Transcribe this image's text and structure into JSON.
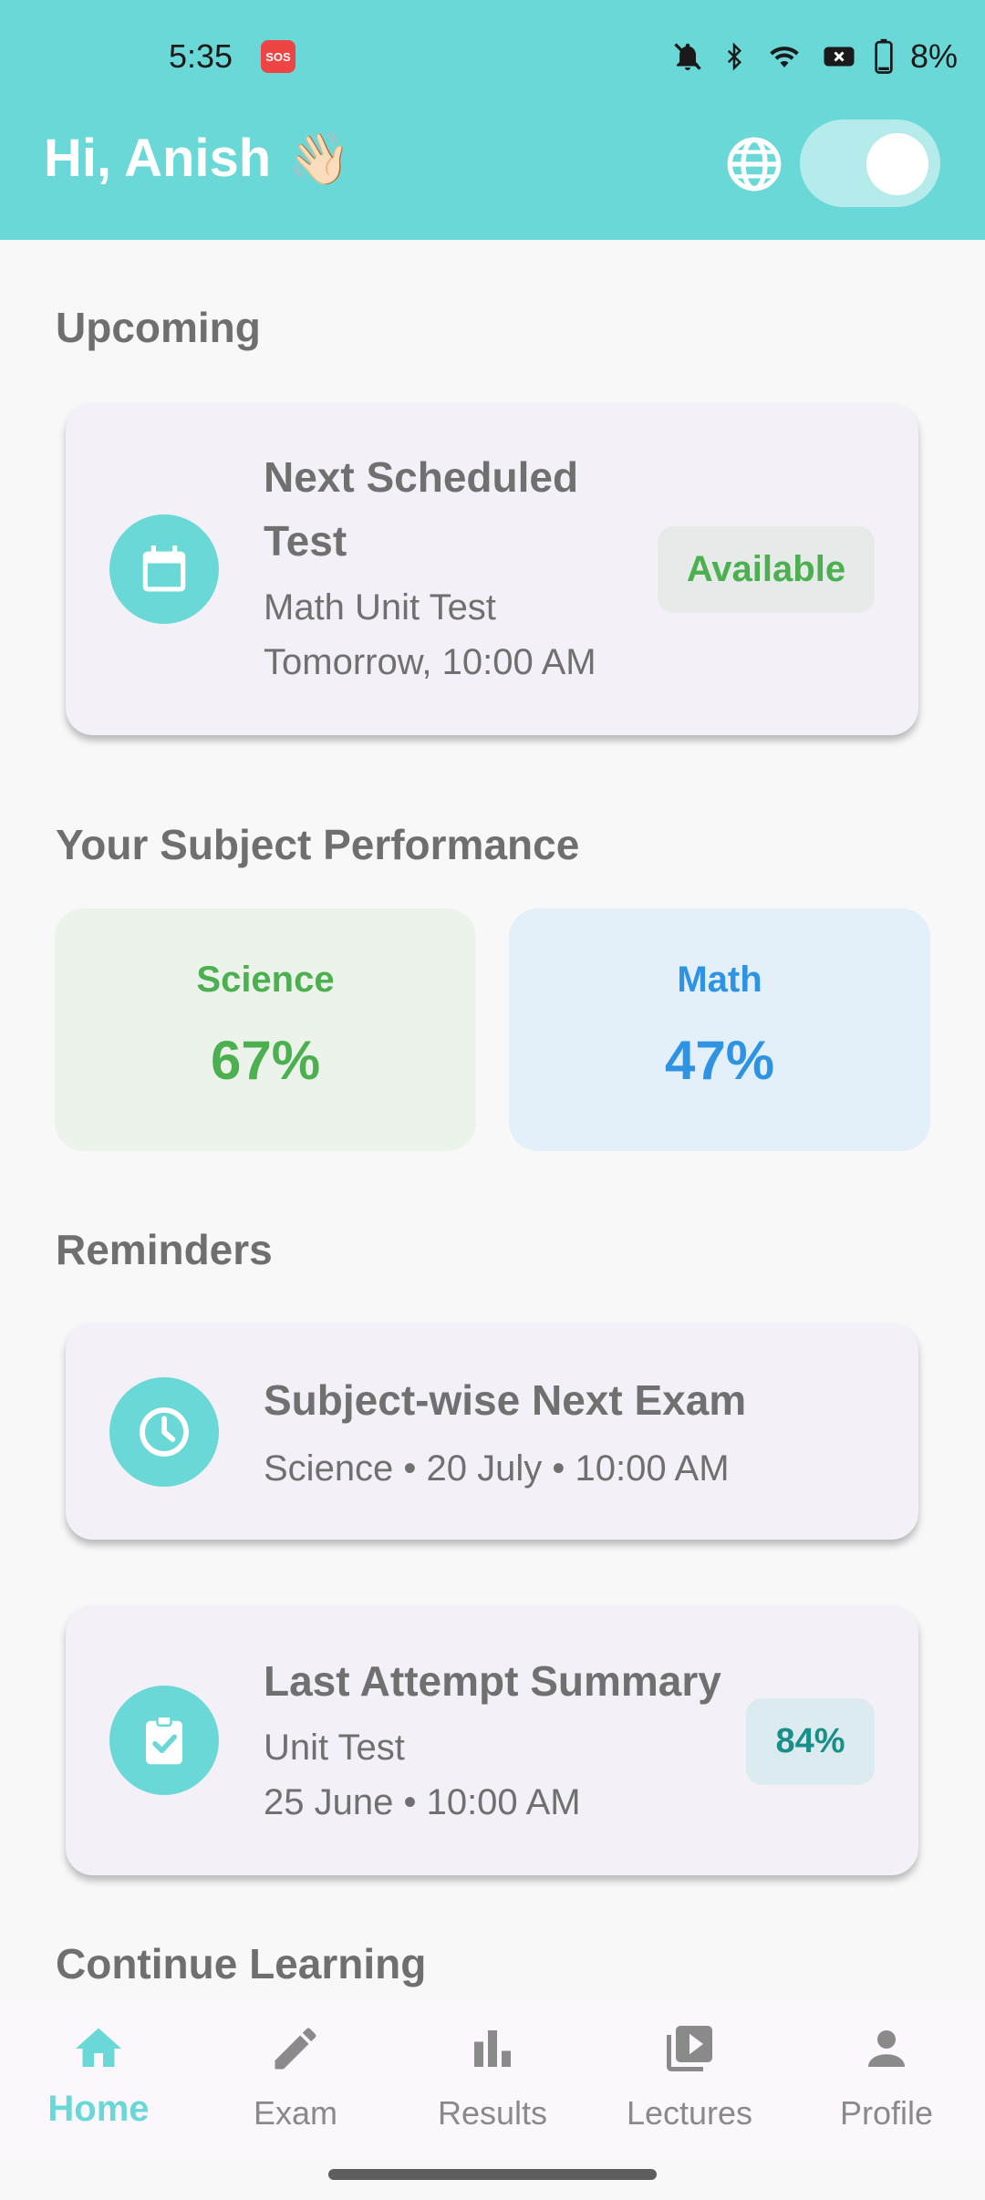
{
  "status_bar": {
    "time": "5:35",
    "sos": "SOS",
    "battery": "8%"
  },
  "header": {
    "greeting": "Hi, Anish",
    "wave": "👋🏻",
    "theme_toggle_on": true
  },
  "upcoming": {
    "title": "Upcoming",
    "card": {
      "title_line1": "Next Scheduled",
      "title_line2": "Test",
      "subject": "Math Unit Test",
      "when": "Tomorrow, 10:00 AM",
      "badge": "Available",
      "icon": "calendar-icon"
    }
  },
  "performance": {
    "title": "Your Subject Performance",
    "subjects": [
      {
        "name": "Science",
        "value": "67%",
        "color": "#4caf50",
        "bg": "#ebf3eb"
      },
      {
        "name": "Math",
        "value": "47%",
        "color": "#2f93e4",
        "bg": "#e3eff9"
      }
    ]
  },
  "reminders": {
    "title": "Reminders",
    "items": [
      {
        "title": "Subject-wise Next Exam",
        "line1": "Science • 20 July • 10:00 AM",
        "icon": "clock-icon"
      },
      {
        "title": "Last Attempt Summary",
        "line1": "Unit Test",
        "line2": "25 June • 10:00 AM",
        "badge": "84%",
        "icon": "clipboard-check-icon"
      }
    ]
  },
  "continue_learning": {
    "title": "Continue Learning"
  },
  "nav": {
    "items": [
      {
        "label": "Home",
        "icon": "home-icon",
        "active": true
      },
      {
        "label": "Exam",
        "icon": "pencil-icon"
      },
      {
        "label": "Results",
        "icon": "bar-chart-icon"
      },
      {
        "label": "Lectures",
        "icon": "video-library-icon"
      },
      {
        "label": "Profile",
        "icon": "person-icon"
      }
    ]
  },
  "colors": {
    "accent": "#6ad8d7",
    "available_green": "#4caf50",
    "badge_teal": "#1a8f8a"
  }
}
